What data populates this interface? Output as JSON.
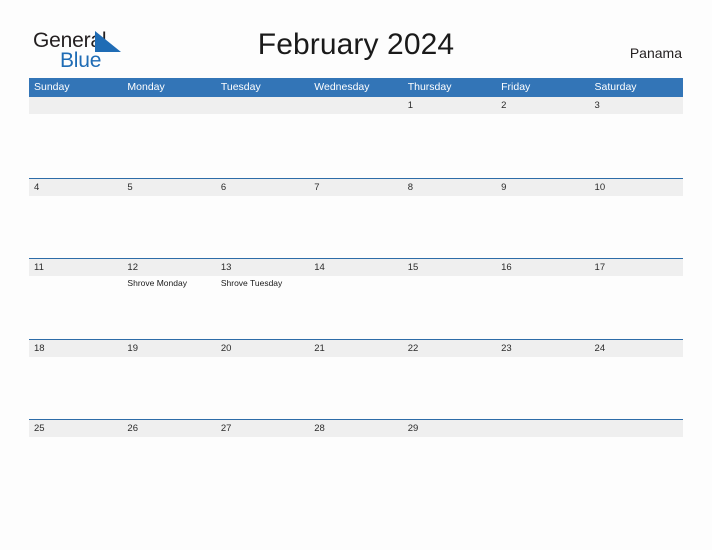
{
  "brand": {
    "name_part1": "General",
    "name_part2": "Blue",
    "mark_icon": "blue-triangle-flag-icon",
    "color_dark": "#231f20",
    "color_blue": "#1f6cb5"
  },
  "header": {
    "title": "February 2024",
    "country": "Panama"
  },
  "theme": {
    "header_blue": "#3375b7",
    "rule_blue": "#2d6ca8",
    "band_gray": "#efefef",
    "page_background": "#fdfdfd"
  },
  "calendar": {
    "day_headers": [
      "Sunday",
      "Monday",
      "Tuesday",
      "Wednesday",
      "Thursday",
      "Friday",
      "Saturday"
    ],
    "weeks": [
      {
        "days": [
          {
            "num": "",
            "events": []
          },
          {
            "num": "",
            "events": []
          },
          {
            "num": "",
            "events": []
          },
          {
            "num": "",
            "events": []
          },
          {
            "num": "1",
            "events": []
          },
          {
            "num": "2",
            "events": []
          },
          {
            "num": "3",
            "events": []
          }
        ]
      },
      {
        "days": [
          {
            "num": "4",
            "events": []
          },
          {
            "num": "5",
            "events": []
          },
          {
            "num": "6",
            "events": []
          },
          {
            "num": "7",
            "events": []
          },
          {
            "num": "8",
            "events": []
          },
          {
            "num": "9",
            "events": []
          },
          {
            "num": "10",
            "events": []
          }
        ]
      },
      {
        "days": [
          {
            "num": "11",
            "events": []
          },
          {
            "num": "12",
            "events": [
              "Shrove Monday"
            ]
          },
          {
            "num": "13",
            "events": [
              "Shrove Tuesday"
            ]
          },
          {
            "num": "14",
            "events": []
          },
          {
            "num": "15",
            "events": []
          },
          {
            "num": "16",
            "events": []
          },
          {
            "num": "17",
            "events": []
          }
        ]
      },
      {
        "days": [
          {
            "num": "18",
            "events": []
          },
          {
            "num": "19",
            "events": []
          },
          {
            "num": "20",
            "events": []
          },
          {
            "num": "21",
            "events": []
          },
          {
            "num": "22",
            "events": []
          },
          {
            "num": "23",
            "events": []
          },
          {
            "num": "24",
            "events": []
          }
        ]
      },
      {
        "days": [
          {
            "num": "25",
            "events": []
          },
          {
            "num": "26",
            "events": []
          },
          {
            "num": "27",
            "events": []
          },
          {
            "num": "28",
            "events": []
          },
          {
            "num": "29",
            "events": []
          },
          {
            "num": "",
            "events": []
          },
          {
            "num": "",
            "events": []
          }
        ]
      }
    ]
  }
}
